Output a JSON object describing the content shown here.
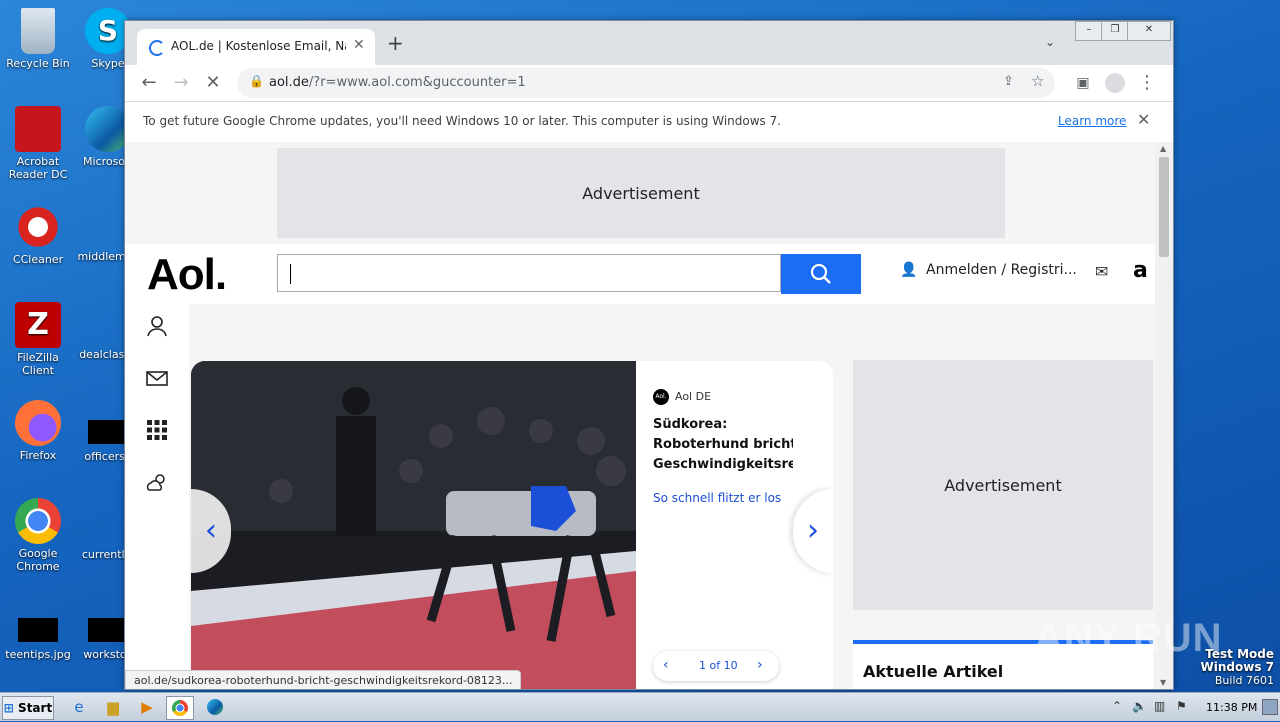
{
  "desktop": {
    "icons": [
      {
        "label": "Recycle Bin",
        "icon": "recycle-bin-icon"
      },
      {
        "label": "Skype",
        "icon": "skype-icon"
      },
      {
        "label": "Acrobat Reader DC",
        "icon": "acrobat-icon"
      },
      {
        "label": "Microsoft",
        "icon": "edge-icon"
      },
      {
        "label": "CCleaner",
        "icon": "ccleaner-icon"
      },
      {
        "label": "middlemac",
        "icon": "file-icon"
      },
      {
        "label": "FileZilla Client",
        "icon": "filezilla-icon"
      },
      {
        "label": "dealclasse",
        "icon": "file-icon"
      },
      {
        "label": "Firefox",
        "icon": "firefox-icon"
      },
      {
        "label": "officerso",
        "icon": "file-icon"
      },
      {
        "label": "Google Chrome",
        "icon": "chrome-icon"
      },
      {
        "label": "currentlyl",
        "icon": "file-icon"
      },
      {
        "label": "teentips.jpg",
        "icon": "image-icon"
      },
      {
        "label": "workstoc",
        "icon": "file-icon"
      }
    ]
  },
  "browser": {
    "tab_title": "AOL.de | Kostenlose Email, Nachrichten",
    "url_domain": "aol.de",
    "url_rest": "/?r=www.aol.com&guccounter=1",
    "infobar_message": "To get future Google Chrome updates, you'll need Windows 10 or later. This computer is using Windows 7.",
    "infobar_link": "Learn more",
    "status_url": "aol.de/sudkorea-roboterhund-bricht-geschwindigkeitsrekord-08123..."
  },
  "page": {
    "ad_label": "Advertisement",
    "logo": "Aol.",
    "signin_label": "Anmelden / Registri...",
    "carousel": {
      "source": "Aol DE",
      "headline_lines": [
        "Südkorea:",
        "Roboterhund bricht",
        "Geschwindigkeitsrekord"
      ],
      "sublink": "So schnell flitzt er los",
      "pager": "1 of 10"
    },
    "side_ad_label": "Advertisement",
    "aktuelle_heading": "Aktuelle Artikel"
  },
  "watermark": "ANY RUN",
  "testmode": {
    "line1": "Test Mode",
    "line2": "Windows 7",
    "line3": "Build 7601"
  },
  "taskbar": {
    "start_label": "Start",
    "clock": "11:38 PM"
  }
}
